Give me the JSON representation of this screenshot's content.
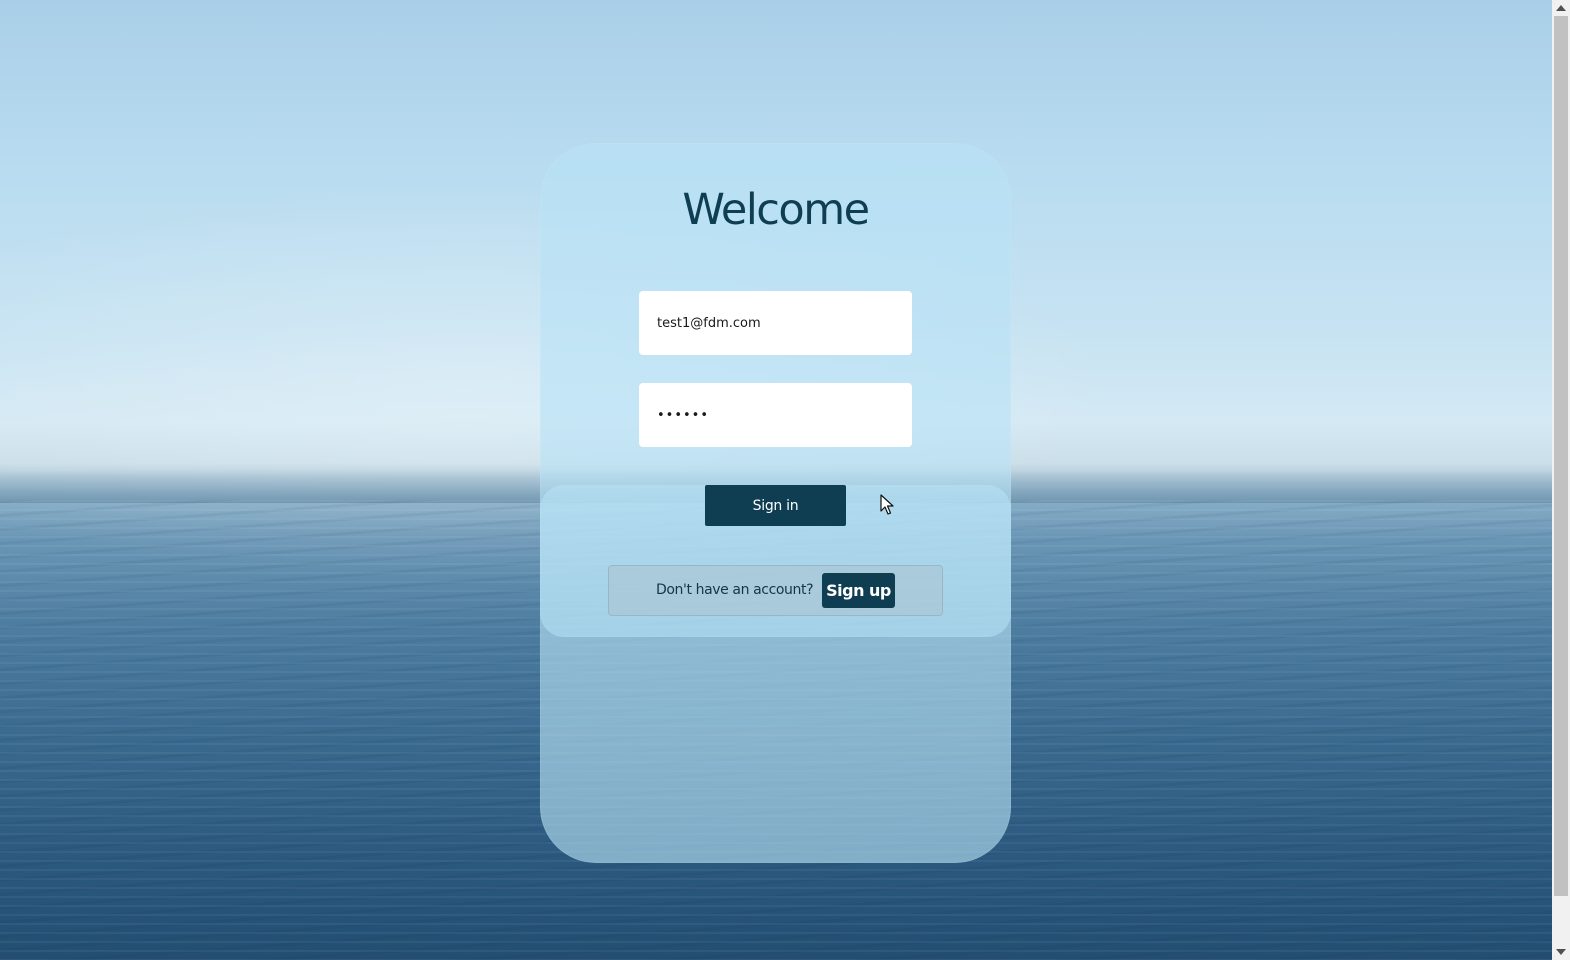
{
  "login": {
    "title": "Welcome",
    "email_value": "test1@fdm.com",
    "password_value": "••••••",
    "signin_label": "Sign in",
    "no_account_text": "Don't have an account?",
    "signup_label": "Sign up"
  },
  "colors": {
    "accent": "#0f3d52",
    "card": "#b8e2f6"
  },
  "icons": {
    "cursor": "mouse-pointer-icon"
  }
}
